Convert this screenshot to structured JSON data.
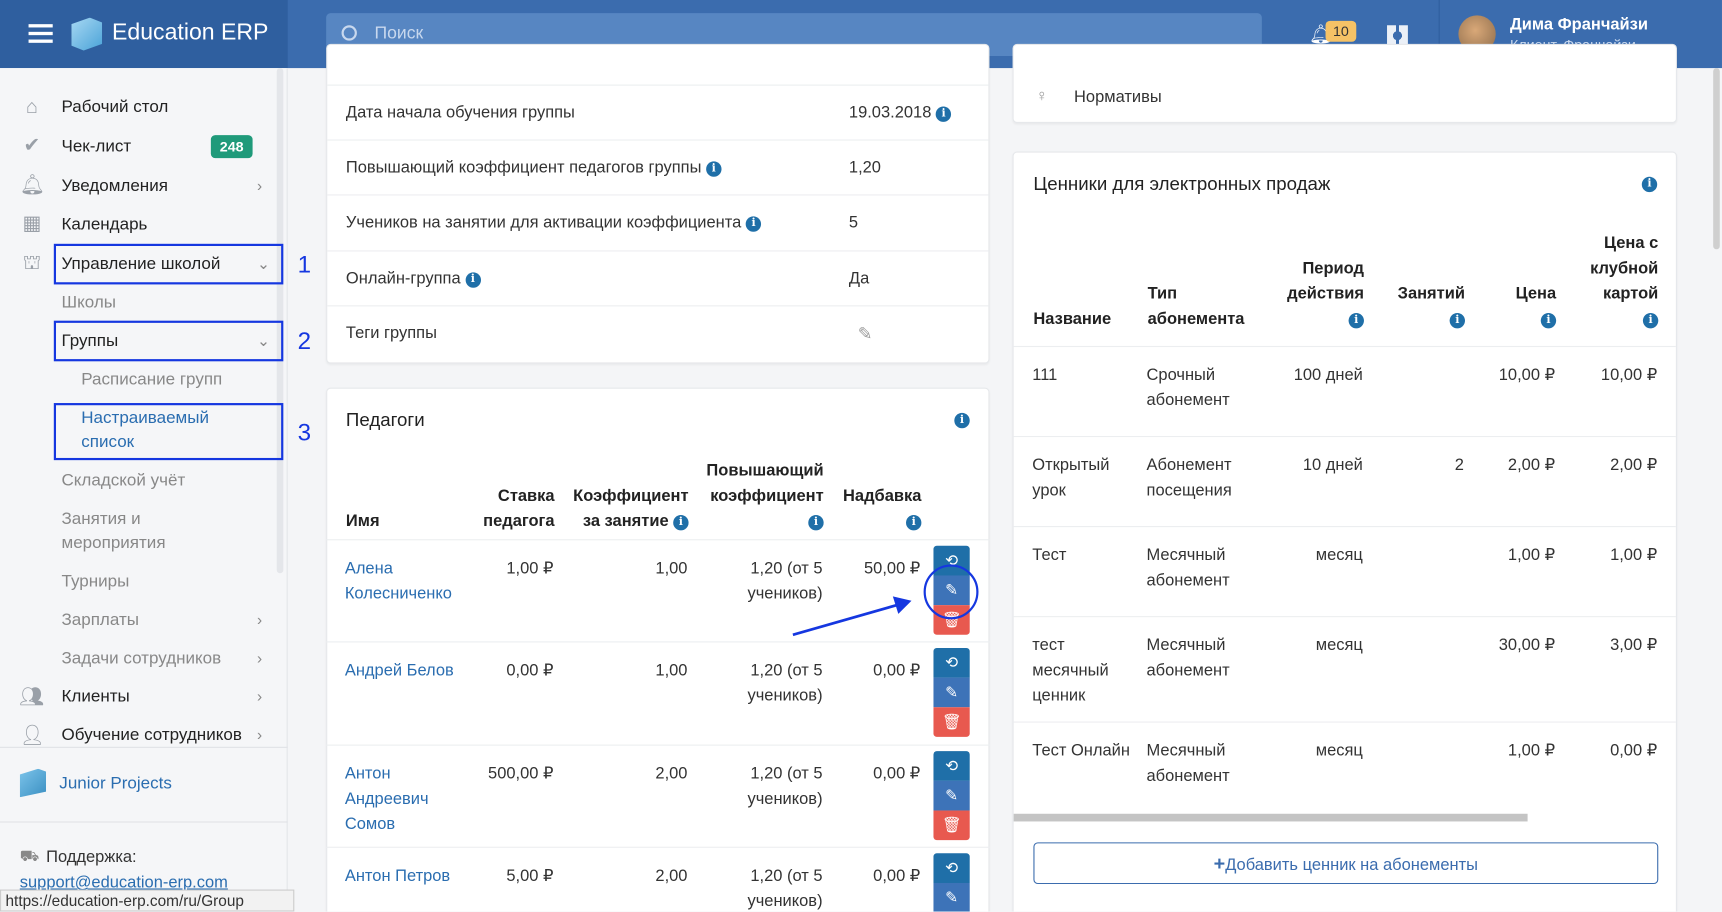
{
  "header": {
    "app_title": "Education ERP",
    "search_placeholder": "Поиск",
    "notifications_count": "10",
    "user_name": "Дима Франчайзи",
    "user_role": "Клиент, Франчайзи"
  },
  "sidebar": {
    "items": [
      {
        "label": "Рабочий стол",
        "icon": "home-icon"
      },
      {
        "label": "Чек-лист",
        "icon": "check-icon",
        "badge": "248"
      },
      {
        "label": "Уведомления",
        "icon": "bell-icon"
      },
      {
        "label": "Календарь",
        "icon": "calendar-icon"
      },
      {
        "label": "Управление школой",
        "icon": "school-icon"
      },
      {
        "label": "Школы"
      },
      {
        "label": "Группы"
      },
      {
        "label": "Расписание групп"
      },
      {
        "label": "Настраиваемый список"
      },
      {
        "label": "Складской учёт"
      },
      {
        "label": "Занятия и мероприятия"
      },
      {
        "label": "Турниры"
      },
      {
        "label": "Зарплаты"
      },
      {
        "label": "Задачи сотрудников"
      },
      {
        "label": "Клиенты",
        "icon": "users-icon"
      },
      {
        "label": "Обучение сотрудников",
        "icon": "teacher-icon"
      }
    ],
    "org_name": "Junior Projects",
    "support_label": "Поддержка:",
    "support_email": "support@education-erp.com"
  },
  "status_url": "https://education-erp.com/ru/Group",
  "group_info": {
    "rows": [
      {
        "label": "Дата начала обучения группы",
        "value": "19.03.2018",
        "info": true
      },
      {
        "label": "Повышающий коэффициент педагогов группы",
        "value": "1,20",
        "label_info": true
      },
      {
        "label": "Учеников на занятии для активации коэффициента",
        "value": "5",
        "label_info": true
      },
      {
        "label": "Онлайн-группа",
        "value": "Да",
        "label_info": true
      },
      {
        "label": "Теги группы",
        "value": ""
      }
    ]
  },
  "teachers": {
    "title": "Педагоги",
    "columns": [
      "Имя",
      "Ставка педагога",
      "Коэффициент за занятие",
      "Повышающий коэффициент",
      "Надбавка"
    ],
    "rows": [
      {
        "name": "Алена Колесниченко",
        "rate": "1,00 ₽",
        "coef": "1,00",
        "boost": "1,20 (от 5 учеников)",
        "bonus": "50,00 ₽"
      },
      {
        "name": "Андрей Белов",
        "rate": "0,00 ₽",
        "coef": "1,00",
        "boost": "1,20 (от 5 учеников)",
        "bonus": "0,00 ₽"
      },
      {
        "name": "Антон Андреевич Сомов",
        "rate": "500,00 ₽",
        "coef": "2,00",
        "boost": "1,20 (от 5 учеников)",
        "bonus": "0,00 ₽"
      },
      {
        "name": "Антон Петров",
        "rate": "5,00 ₽",
        "coef": "2,00",
        "boost": "1,20 (от 5 учеников)",
        "bonus": "0,00 ₽"
      }
    ]
  },
  "standards": {
    "label": "Нормативы"
  },
  "prices": {
    "title": "Ценники для электронных продаж",
    "columns": [
      "Название",
      "Тип абонемента",
      "Период действия",
      "Занятий",
      "Цена",
      "Цена с клубной картой"
    ],
    "rows": [
      {
        "name": "111",
        "type": "Срочный абонемент",
        "period": "100 дней",
        "lessons": "",
        "price": "10,00 ₽",
        "club": "10,00 ₽"
      },
      {
        "name": "Открытый урок",
        "type": "Абонемент посещения",
        "period": "10 дней",
        "lessons": "2",
        "price": "2,00 ₽",
        "club": "2,00 ₽"
      },
      {
        "name": "Тест",
        "type": "Месячный абонемент",
        "period": "месяц",
        "lessons": "",
        "price": "1,00 ₽",
        "club": "1,00 ₽"
      },
      {
        "name": "тест месячный ценник",
        "type": "Месячный абонемент",
        "period": "месяц",
        "lessons": "",
        "price": "30,00 ₽",
        "club": "3,00 ₽"
      },
      {
        "name": "Тест Онлайн",
        "type": "Месячный абонемент",
        "period": "месяц",
        "lessons": "",
        "price": "1,00 ₽",
        "club": "0,00 ₽"
      }
    ],
    "add_button": "Добавить ценник на абонементы"
  },
  "annotations": [
    "1",
    "2",
    "3"
  ]
}
